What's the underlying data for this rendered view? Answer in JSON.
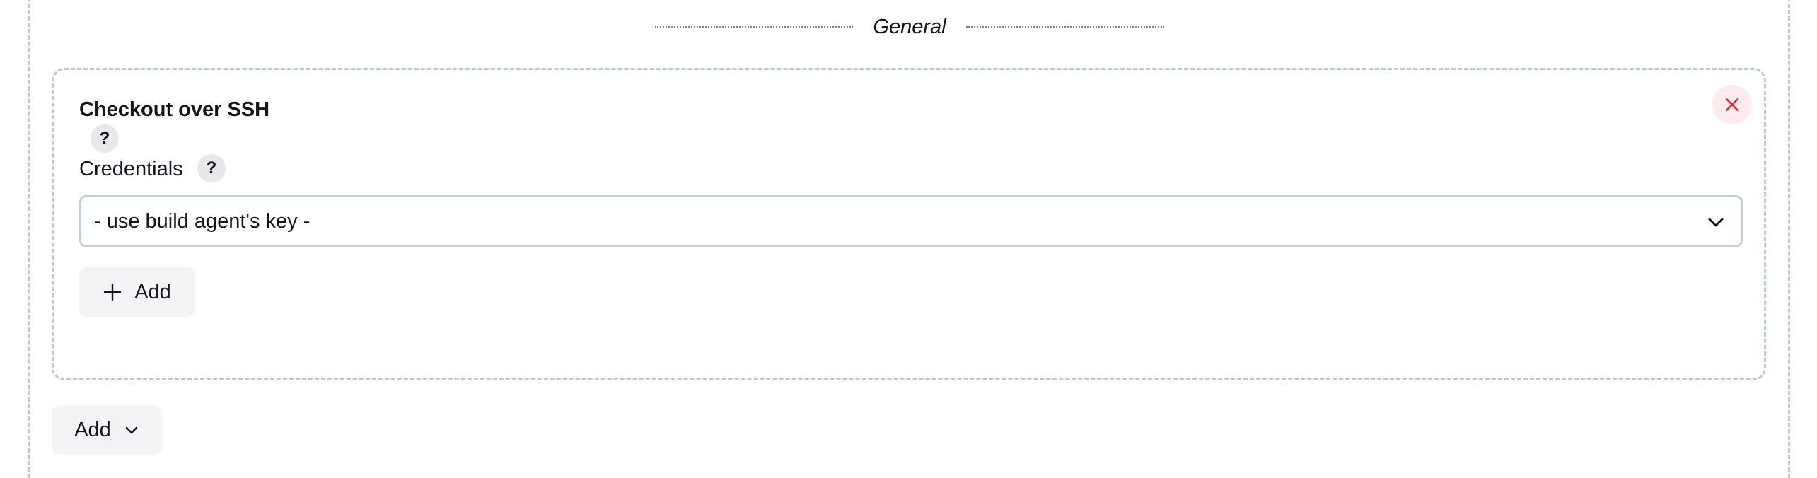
{
  "section": {
    "title": "General"
  },
  "card": {
    "title": "Checkout over SSH",
    "help_label": "?",
    "credentials_label": "Credentials",
    "credentials_select": {
      "selected": "- use build agent's key -"
    },
    "add_label": "Add"
  },
  "footer": {
    "add_label": "Add"
  },
  "icons": {
    "close": "close-icon",
    "chevron": "chevron-down-icon",
    "plus": "plus-icon"
  },
  "colors": {
    "dashed_border": "#b9c9cc",
    "close_icon": "#e0242b",
    "close_bg": "#fdecee",
    "button_bg": "#f4f4f6"
  }
}
